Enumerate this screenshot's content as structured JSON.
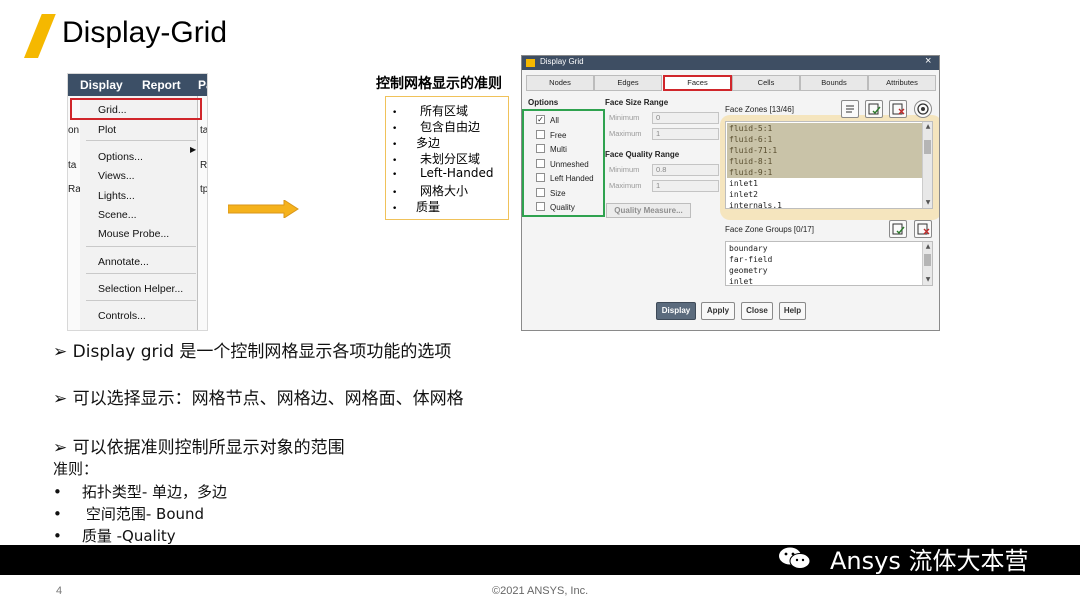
{
  "slide": {
    "title": "Display-Grid",
    "page_number": "4",
    "copyright": "©2021 ANSYS, Inc.",
    "watermark": "Ansys 流体大本营",
    "accent_color": "#f5b800"
  },
  "menu": {
    "topbar": [
      "Display",
      "Report",
      "Pa"
    ],
    "left_fragments": [
      "on",
      "ta",
      "Ra"
    ],
    "right_fragments": [
      "ta",
      "R",
      "tp"
    ],
    "items": [
      "Grid...",
      "Plot",
      "Options...",
      "Views...",
      "Lights...",
      "Scene...",
      "Mouse Probe...",
      "Annotate...",
      "Selection Helper...",
      "Controls..."
    ]
  },
  "criteria": {
    "heading": "控制网格显示的准则",
    "bullet": "•",
    "items": [
      "所有区域",
      "包含自由边",
      "多边",
      "未划分区域",
      "Left-Handed",
      "网格大小",
      "质量"
    ]
  },
  "dialog": {
    "title": "Display Grid",
    "close": "×",
    "tabs": [
      "Nodes",
      "Edges",
      "Faces",
      "Cells",
      "Bounds",
      "Attributes"
    ],
    "active_tab": "Faces",
    "options_label": "Options",
    "options": [
      {
        "label": "All",
        "checked": "✓"
      },
      {
        "label": "Free",
        "checked": ""
      },
      {
        "label": "Multi",
        "checked": ""
      },
      {
        "label": "Unmeshed",
        "checked": ""
      },
      {
        "label": "Left Handed",
        "checked": ""
      },
      {
        "label": "Size",
        "checked": ""
      },
      {
        "label": "Quality",
        "checked": ""
      }
    ],
    "face_size_range": {
      "label": "Face Size Range",
      "min_label": "Minimum",
      "min": "0",
      "max_label": "Maximum",
      "max": "1"
    },
    "face_quality_range": {
      "label": "Face Quality Range",
      "min_label": "Minimum",
      "min": "0.8",
      "max_label": "Maximum",
      "max": "1"
    },
    "quality_measure": "Quality Measure...",
    "face_zones": {
      "label": "Face Zones [13/46]",
      "items": [
        "fluid-5:1",
        "fluid-6:1",
        "fluid-71:1",
        "fluid-8:1",
        "fluid-9:1",
        "inlet1",
        "inlet2",
        "internals.1"
      ],
      "selected_count": 5
    },
    "face_zone_groups": {
      "label": "Face Zone Groups [0/17]",
      "items": [
        "boundary",
        "far-field",
        "geometry",
        "inlet"
      ]
    },
    "buttons": {
      "display": "Display",
      "apply": "Apply",
      "close": "Close",
      "help": "Help"
    }
  },
  "body": {
    "arrow_glyph": "➢",
    "line1": "Display grid 是一个控制网格显示各项功能的选项",
    "line2": "可以选择显示：网格节点、网格边、网格面、体网格",
    "line3": "可以依据准则控制所显示对象的范围",
    "criteria_title": "准则：",
    "criteria_lines": [
      "拓扑类型-   单边，多边",
      "空间范围- Bound",
      "质量  -Quality"
    ]
  }
}
